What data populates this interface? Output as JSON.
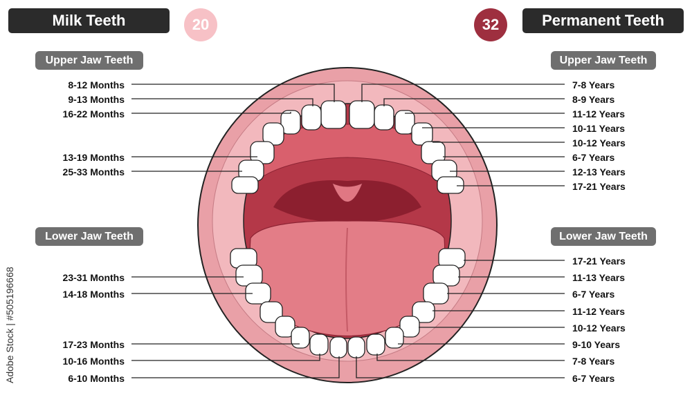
{
  "milk": {
    "title": "Milk Teeth",
    "count": "20",
    "upper_header": "Upper Jaw Teeth",
    "lower_header": "Lower Jaw Teeth",
    "upper": [
      "8-12 Months",
      "9-13 Months",
      "16-22 Months",
      "13-19 Months",
      "25-33 Months"
    ],
    "lower": [
      "23-31 Months",
      "14-18 Months",
      "17-23 Months",
      "10-16 Months",
      "6-10 Months"
    ]
  },
  "permanent": {
    "title": "Permanent Teeth",
    "count": "32",
    "upper_header": "Upper Jaw Teeth",
    "lower_header": "Lower Jaw Teeth",
    "upper": [
      "7-8 Years",
      "8-9 Years",
      "11-12 Years",
      "10-11 Years",
      "10-12 Years",
      "6-7 Years",
      "12-13 Years",
      "17-21 Years"
    ],
    "lower": [
      "17-21 Years",
      "11-13 Years",
      "6-7 Years",
      "11-12 Years",
      "10-12 Years",
      "9-10 Years",
      "7-8 Years",
      "6-7 Years"
    ]
  },
  "watermark": "Adobe Stock | #505196668",
  "colors": {
    "title_bg": "#2b2b2b",
    "section_bg": "#6f6f6f",
    "milk_count_bg": "#f7c1c6",
    "permanent_count_bg": "#9e2f3f",
    "lip": "#e9a0a7",
    "mouth_dark": "#b43848",
    "tongue": "#e37d87",
    "tooth": "#ffffff"
  }
}
